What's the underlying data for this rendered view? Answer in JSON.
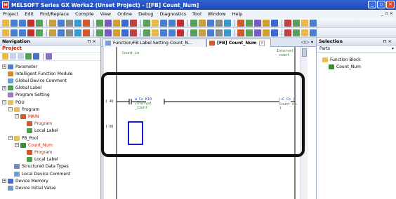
{
  "window": {
    "title": "MELSOFT Series GX Works2 (Unset Project) - [[FB] Count_Num]",
    "app_icon": "melsoft-icon",
    "controls": [
      "minimize-icon",
      "restore-icon",
      "close-icon"
    ]
  },
  "menu": {
    "items": [
      "Project",
      "Edit",
      "Find/Replace",
      "Compile",
      "View",
      "Online",
      "Debug",
      "Diagnostics",
      "Tool",
      "Window",
      "Help"
    ],
    "mdi_controls": "_ ▫ ×"
  },
  "navigation": {
    "title": "Navigation",
    "pin": "⊓ ×",
    "project_label": "Project",
    "tree": [
      {
        "label": "Parameter",
        "indent": 0,
        "expander": "+",
        "icon": "parameter-icon"
      },
      {
        "label": "Intelligent Function Module",
        "indent": 0,
        "expander": "",
        "icon": "module-icon"
      },
      {
        "label": "Global Device Comment",
        "indent": 0,
        "expander": "",
        "icon": "comment-icon"
      },
      {
        "label": "Global Label",
        "indent": 0,
        "expander": "+",
        "icon": "label-icon"
      },
      {
        "label": "Program Setting",
        "indent": 0,
        "expander": "",
        "icon": "setting-icon"
      },
      {
        "label": "POU",
        "indent": 0,
        "expander": "−",
        "icon": "folder-icon"
      },
      {
        "label": "Program",
        "indent": 1,
        "expander": "−",
        "icon": "folder-icon"
      },
      {
        "label": "MAIN",
        "indent": 2,
        "expander": "−",
        "icon": "program-icon",
        "red": true
      },
      {
        "label": "Program",
        "indent": 3,
        "expander": "",
        "icon": "ladder-icon",
        "red": true
      },
      {
        "label": "Local Label",
        "indent": 3,
        "expander": "",
        "icon": "label-icon"
      },
      {
        "label": "FB_Pool",
        "indent": 1,
        "expander": "−",
        "icon": "folder-icon"
      },
      {
        "label": "Count_Num",
        "indent": 2,
        "expander": "−",
        "icon": "fb-icon",
        "red": true
      },
      {
        "label": "Program",
        "indent": 3,
        "expander": "",
        "icon": "ladder-icon",
        "red": true
      },
      {
        "label": "Local Label",
        "indent": 3,
        "expander": "",
        "icon": "label-icon"
      },
      {
        "label": "Structured Data Types",
        "indent": 1,
        "expander": "",
        "icon": "struct-icon"
      },
      {
        "label": "Local Device Comment",
        "indent": 1,
        "expander": "",
        "icon": "comment-icon"
      },
      {
        "label": "Device Memory",
        "indent": 0,
        "expander": "+",
        "icon": "memory-icon"
      },
      {
        "label": "Device Initial Value",
        "indent": 0,
        "expander": "",
        "icon": "initial-value-icon"
      }
    ]
  },
  "editor": {
    "tabs": [
      {
        "label": "Function/FB Label Setting Count_N...",
        "active": false
      },
      {
        "label": "[FB] Count_Num",
        "active": true,
        "close": "×"
      }
    ],
    "tab_nav": "◁ ▷ ▾",
    "ladder": {
      "top_left_label": "Count_in",
      "top_right_label": "Interval\n_count",
      "step_4": "(   4)",
      "contact_dev": "w_Co   K10",
      "contact_sub": "Interval\n_count",
      "coil_label": "(→C_Co )",
      "coil_sub": "Count_ou\nt",
      "step_8": "(   8)"
    }
  },
  "selection": {
    "title": "Selection",
    "pin": "⊓ ×",
    "parts_label": "Parts",
    "items": [
      {
        "label": "Function Block",
        "indent": 0,
        "icon": "folder-icon"
      },
      {
        "label": "Count_Num",
        "indent": 1,
        "icon": "fb-icon"
      }
    ]
  }
}
